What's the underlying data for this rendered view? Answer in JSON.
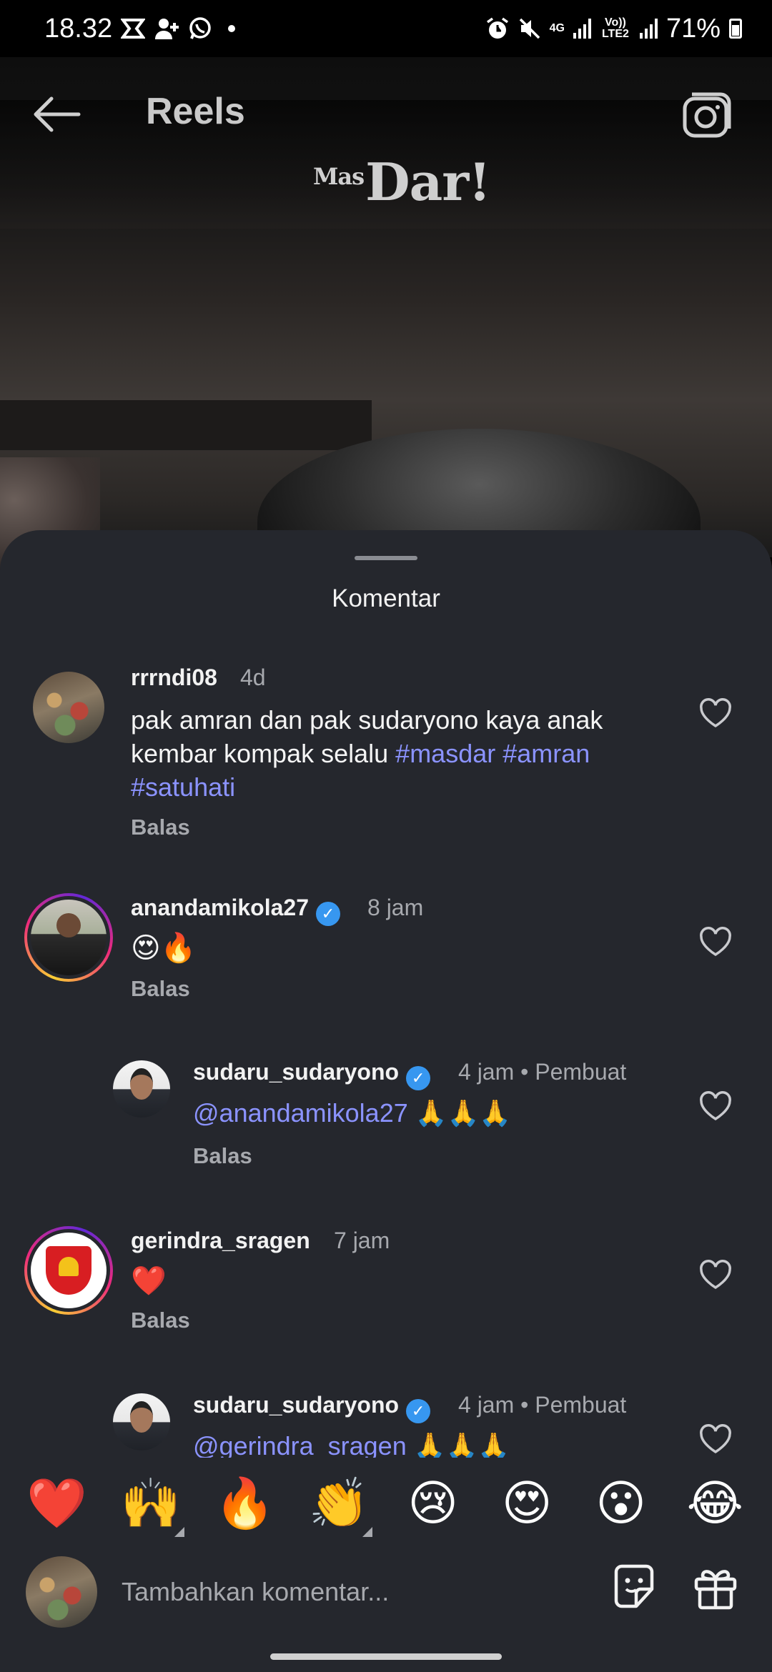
{
  "status_bar": {
    "time": "18.32",
    "net_type": "4G",
    "volte": "Vo)) LTE2",
    "battery": "71%"
  },
  "nav": {
    "title": "Reels",
    "back_icon": "arrow-left-icon",
    "camera_icon": "camera-icon"
  },
  "reel": {
    "logo_small": "Mas",
    "logo_main": "Dar!"
  },
  "sheet": {
    "title": "Komentar"
  },
  "comments": [
    {
      "username": "rrrndi08",
      "time": "4d",
      "text_plain": "pak amran dan pak sudaryono kaya anak kembar kompak selalu ",
      "hashtags": [
        "#masdar",
        "#amran",
        "#satuhati"
      ],
      "reply_label": "Balas"
    },
    {
      "username": "anandamikola27",
      "verified": true,
      "time": "8 jam",
      "text": "😍🔥",
      "reply_label": "Balas"
    },
    {
      "username": "sudaru_sudaryono",
      "verified": true,
      "time": "4 jam",
      "author_label": "Pembuat",
      "mention": "@anandamikola27",
      "text": "🙏🙏🙏",
      "reply_label": "Balas"
    },
    {
      "username": "gerindra_sragen",
      "time": "7 jam",
      "text": "❤️",
      "reply_label": "Balas"
    },
    {
      "username": "sudaru_sudaryono",
      "verified": true,
      "time": "4 jam",
      "author_label": "Pembuat",
      "mention": "@gerindra_sragen",
      "text": "🙏🙏🙏"
    }
  ],
  "verified_mark": "✓",
  "meta_separator": "•",
  "emoji_bar": [
    "❤️",
    "🙌",
    "🔥",
    "👏",
    "😢",
    "😍",
    "😮",
    "😂"
  ],
  "input": {
    "placeholder": "Tambahkan komentar..."
  },
  "colors": {
    "sheet_bg": "#25272d",
    "link": "#8b93ff",
    "verified": "#3797f0",
    "muted": "#a7a9ae"
  }
}
